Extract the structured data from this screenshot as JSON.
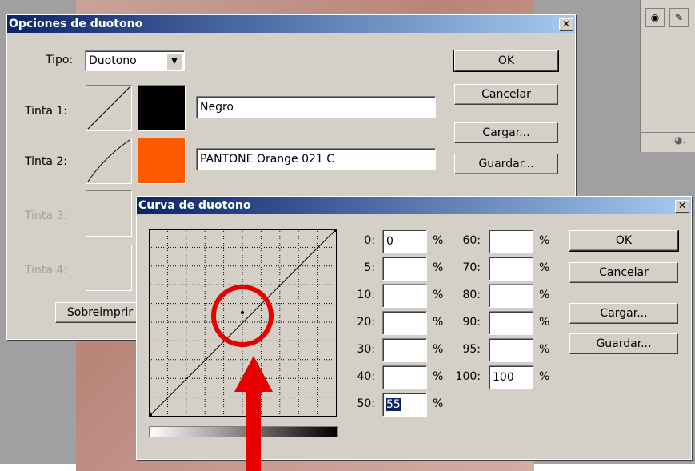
{
  "colors": {
    "title_start": "#0a246a",
    "title_end": "#a6caf0",
    "face": "#d4d0c8",
    "ink2": "#ff5a00",
    "annotation": "#e60000"
  },
  "duotone_dialog": {
    "title": "Opciones de duotono",
    "close_icon": "close-icon",
    "tipo_label": "Tipo:",
    "tipo_value": "Duotono",
    "inks": [
      {
        "label": "Tinta 1:",
        "name": "Negro",
        "color": "#000000"
      },
      {
        "label": "Tinta 2:",
        "name": "PANTONE Orange 021 C",
        "color": "#ff5a00"
      },
      {
        "label": "Tinta 3:"
      },
      {
        "label": "Tinta 4:"
      }
    ],
    "overprint_button": "Sobreimprir",
    "buttons": {
      "ok": "OK",
      "cancel": "Cancelar",
      "load": "Cargar...",
      "save": "Guardar..."
    }
  },
  "curve_dialog": {
    "title": "Curva de duotono",
    "close_icon": "close-icon",
    "fields_left": [
      {
        "label": "0:",
        "value": "0"
      },
      {
        "label": "5:",
        "value": ""
      },
      {
        "label": "10:",
        "value": ""
      },
      {
        "label": "20:",
        "value": ""
      },
      {
        "label": "30:",
        "value": ""
      },
      {
        "label": "40:",
        "value": ""
      },
      {
        "label": "50:",
        "value": "55"
      }
    ],
    "fields_right": [
      {
        "label": "60:",
        "value": ""
      },
      {
        "label": "70:",
        "value": ""
      },
      {
        "label": "80:",
        "value": ""
      },
      {
        "label": "90:",
        "value": ""
      },
      {
        "label": "95:",
        "value": ""
      },
      {
        "label": "100:",
        "value": "100"
      }
    ],
    "percent": "%",
    "buttons": {
      "ok": "OK",
      "cancel": "Cancelar",
      "load": "Cargar...",
      "save": "Guardar..."
    }
  },
  "palette": {
    "eye_icon": "eye-icon",
    "brush_icon": "brush-icon",
    "menu_icon": "palette-menu-icon"
  }
}
